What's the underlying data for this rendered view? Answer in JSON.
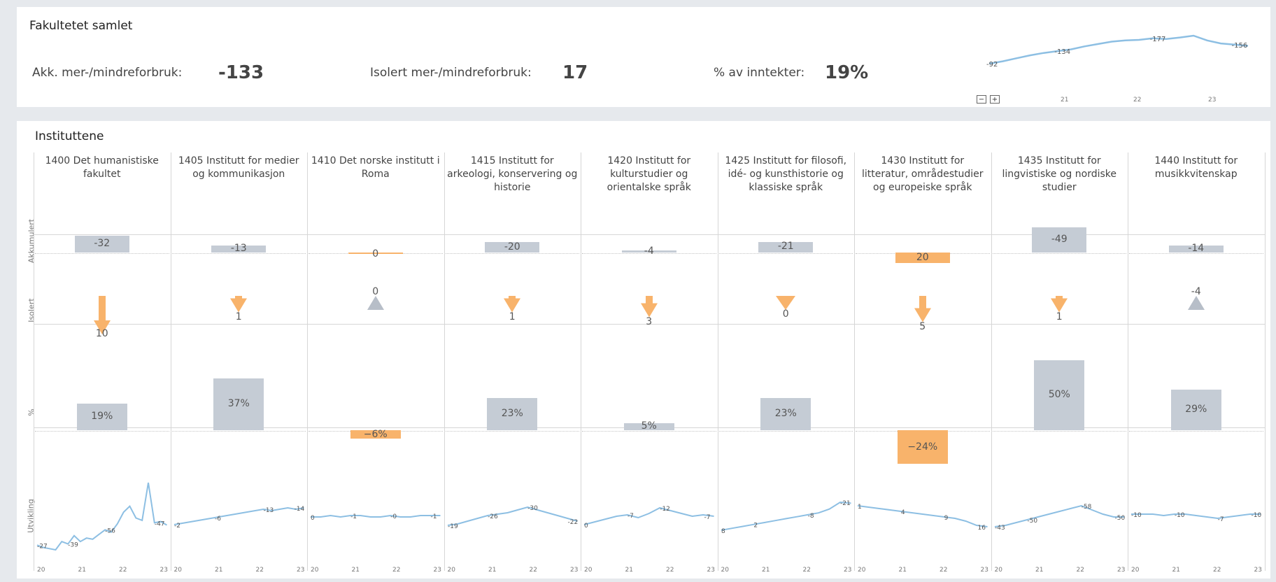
{
  "summary": {
    "title": "Fakultetet samlet",
    "kpis": [
      {
        "label": "Akk. mer-/mindreforbruk:",
        "value": "-133"
      },
      {
        "label": "Isolert mer-/mindreforbruk:",
        "value": "17"
      },
      {
        "label": "% av inntekter:",
        "value": "19%"
      }
    ],
    "sparkline": {
      "points": [
        -92,
        -100,
        -110,
        -120,
        -128,
        -134,
        -140,
        -150,
        -158,
        -166,
        -170,
        -172,
        -177,
        -175,
        -180,
        -186,
        -170,
        -160,
        -156,
        -152
      ],
      "labels": [
        {
          "idx": 0,
          "text": "-92"
        },
        {
          "idx": 5,
          "text": "-134"
        },
        {
          "idx": 12,
          "text": "-177"
        },
        {
          "idx": 18,
          "text": "-156"
        }
      ],
      "x_ticks": [
        "21",
        "22",
        "23"
      ],
      "controls": [
        "−",
        "+"
      ]
    }
  },
  "institutes": {
    "title": "Instituttene",
    "row_labels": [
      "Akkumulert",
      "Isolert",
      "%",
      "Utvikling"
    ],
    "x_ticks": [
      "20",
      "21",
      "22",
      "23"
    ],
    "columns": [
      {
        "name": "1400 Det humanistiske fakultet",
        "akk": -32,
        "akk_label": "-32",
        "iso": 10,
        "iso_label": "10",
        "iso_dir": "down",
        "pct": 19,
        "pct_label": "19%",
        "spark": [
          -27,
          -25,
          -24,
          -23,
          -30,
          -28,
          -35,
          -30,
          -33,
          -32,
          -36,
          -40,
          -38,
          -45,
          -55,
          -60,
          -50,
          -48,
          -80,
          -46,
          -47,
          -44
        ],
        "spark_labels": [
          {
            "idx": 0,
            "text": "-27"
          },
          {
            "idx": 5,
            "text": "-39"
          },
          {
            "idx": 11,
            "text": "-56"
          },
          {
            "idx": 19,
            "text": "-47"
          }
        ]
      },
      {
        "name": "1405 Institutt for medier og kommunikasjon",
        "akk": -13,
        "akk_label": "-13",
        "iso": 1,
        "iso_label": "1",
        "iso_dir": "down",
        "pct": 37,
        "pct_label": "37%",
        "spark": [
          -2,
          -3,
          -4,
          -5,
          -6,
          -7,
          -8,
          -9,
          -10,
          -11,
          -12,
          -13,
          -12,
          -13,
          -14,
          -13,
          -14
        ],
        "spark_labels": [
          {
            "idx": 0,
            "text": "-2"
          },
          {
            "idx": 5,
            "text": "-6"
          },
          {
            "idx": 11,
            "text": "-13"
          },
          {
            "idx": 16,
            "text": "-14"
          }
        ]
      },
      {
        "name": "1410 Det norske institutt i Roma",
        "akk": 0,
        "akk_label": "0",
        "iso": 0,
        "iso_label": "0",
        "iso_dir": "up",
        "pct": -6,
        "pct_label": "−6%",
        "spark": [
          0,
          0,
          -1,
          0,
          -1,
          -1,
          0,
          0,
          -1,
          0,
          0,
          -1,
          -1,
          -1
        ],
        "spark_labels": [
          {
            "idx": 0,
            "text": "0"
          },
          {
            "idx": 4,
            "text": "-1"
          },
          {
            "idx": 8,
            "text": "-0"
          },
          {
            "idx": 13,
            "text": "-1"
          }
        ]
      },
      {
        "name": "1415 Institutt for arkeologi, konservering og historie",
        "akk": -20,
        "akk_label": "-20",
        "iso": 1,
        "iso_label": "1",
        "iso_dir": "down",
        "pct": 23,
        "pct_label": "23%",
        "spark": [
          -19,
          -20,
          -22,
          -24,
          -26,
          -27,
          -28,
          -30,
          -32,
          -30,
          -28,
          -26,
          -24,
          -22
        ],
        "spark_labels": [
          {
            "idx": 0,
            "text": "-19"
          },
          {
            "idx": 4,
            "text": "-26"
          },
          {
            "idx": 8,
            "text": "-30"
          },
          {
            "idx": 13,
            "text": "-22"
          }
        ]
      },
      {
        "name": "1420 Institutt for kulturstudier og orientalske språk",
        "akk": -4,
        "akk_label": "-4",
        "iso": 3,
        "iso_label": "3",
        "iso_dir": "down",
        "pct": 5,
        "pct_label": "5%",
        "spark": [
          0,
          -2,
          -4,
          -6,
          -7,
          -5,
          -8,
          -12,
          -10,
          -8,
          -6,
          -7,
          -6
        ],
        "spark_labels": [
          {
            "idx": 0,
            "text": "0"
          },
          {
            "idx": 4,
            "text": "-7"
          },
          {
            "idx": 7,
            "text": "-12"
          },
          {
            "idx": 12,
            "text": "-7"
          }
        ]
      },
      {
        "name": "1425 Institutt for filosofi, idé- og kunsthistorie og klassiske språk",
        "akk": -21,
        "akk_label": "-21",
        "iso": 0,
        "iso_label": "0",
        "iso_dir": "down",
        "pct": 23,
        "pct_label": "23%",
        "spark": [
          8,
          6,
          4,
          2,
          0,
          -2,
          -4,
          -6,
          -8,
          -10,
          -14,
          -21,
          -20
        ],
        "spark_labels": [
          {
            "idx": 0,
            "text": "8"
          },
          {
            "idx": 3,
            "text": "2"
          },
          {
            "idx": 8,
            "text": "-8"
          },
          {
            "idx": 11,
            "text": "-21"
          }
        ]
      },
      {
        "name": "1430 Institutt for litteratur, områdestudier og europeiske språk",
        "akk": 20,
        "akk_label": "20",
        "iso": 5,
        "iso_label": "5",
        "iso_dir": "down",
        "pct": -24,
        "pct_label": "−24%",
        "spark": [
          1,
          2,
          3,
          4,
          5,
          6,
          7,
          8,
          9,
          10,
          12,
          15,
          16
        ],
        "spark_labels": [
          {
            "idx": 0,
            "text": "1"
          },
          {
            "idx": 4,
            "text": "4"
          },
          {
            "idx": 8,
            "text": "9"
          },
          {
            "idx": 12,
            "text": "16"
          }
        ]
      },
      {
        "name": "1435 Institutt for lingvistiske og nordiske studier",
        "akk": -49,
        "akk_label": "-49",
        "iso": 1,
        "iso_label": "1",
        "iso_dir": "down",
        "pct": 50,
        "pct_label": "50%",
        "spark": [
          -43,
          -44,
          -46,
          -48,
          -50,
          -52,
          -54,
          -56,
          -58,
          -55,
          -52,
          -50,
          -50
        ],
        "spark_labels": [
          {
            "idx": 0,
            "text": "-43"
          },
          {
            "idx": 3,
            "text": "-50"
          },
          {
            "idx": 8,
            "text": "-58"
          },
          {
            "idx": 12,
            "text": "-50"
          }
        ]
      },
      {
        "name": "1440 Institutt for musikkvitenskap",
        "akk": -14,
        "akk_label": "-14",
        "iso": -4,
        "iso_label": "-4",
        "iso_dir": "up",
        "pct": 29,
        "pct_label": "29%",
        "spark": [
          -10,
          -10,
          -10,
          -9,
          -10,
          -10,
          -9,
          -8,
          -7,
          -8,
          -9,
          -10,
          -10
        ],
        "spark_labels": [
          {
            "idx": 0,
            "text": "-10"
          },
          {
            "idx": 4,
            "text": "-10"
          },
          {
            "idx": 8,
            "text": "-7"
          },
          {
            "idx": 12,
            "text": "-10"
          }
        ]
      }
    ]
  },
  "colors": {
    "gray_bar": "#c5ccd5",
    "orange_bar": "#f8b36b",
    "line": "#8dbfe3"
  }
}
